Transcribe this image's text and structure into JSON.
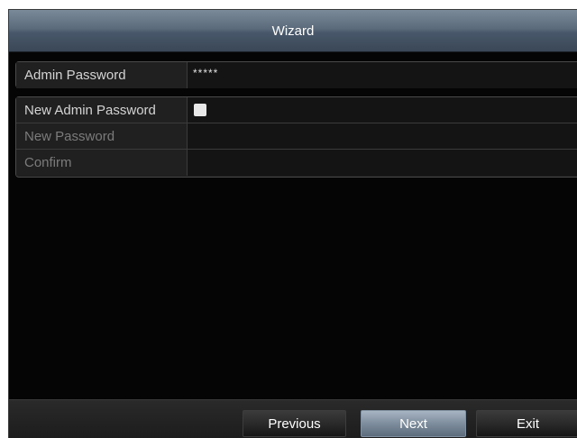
{
  "window": {
    "title": "Wizard"
  },
  "admin": {
    "label": "Admin Password",
    "value": "*****"
  },
  "new_password_section": {
    "toggle_label": "New Admin Password",
    "toggle_checked": false,
    "new_password_label": "New Password",
    "confirm_label": "Confirm"
  },
  "buttons": {
    "previous": "Previous",
    "next": "Next",
    "exit": "Exit"
  },
  "colors": {
    "title_bar": "#5b6b7b",
    "next_button": "#7e8d9d",
    "background": "#050505"
  }
}
